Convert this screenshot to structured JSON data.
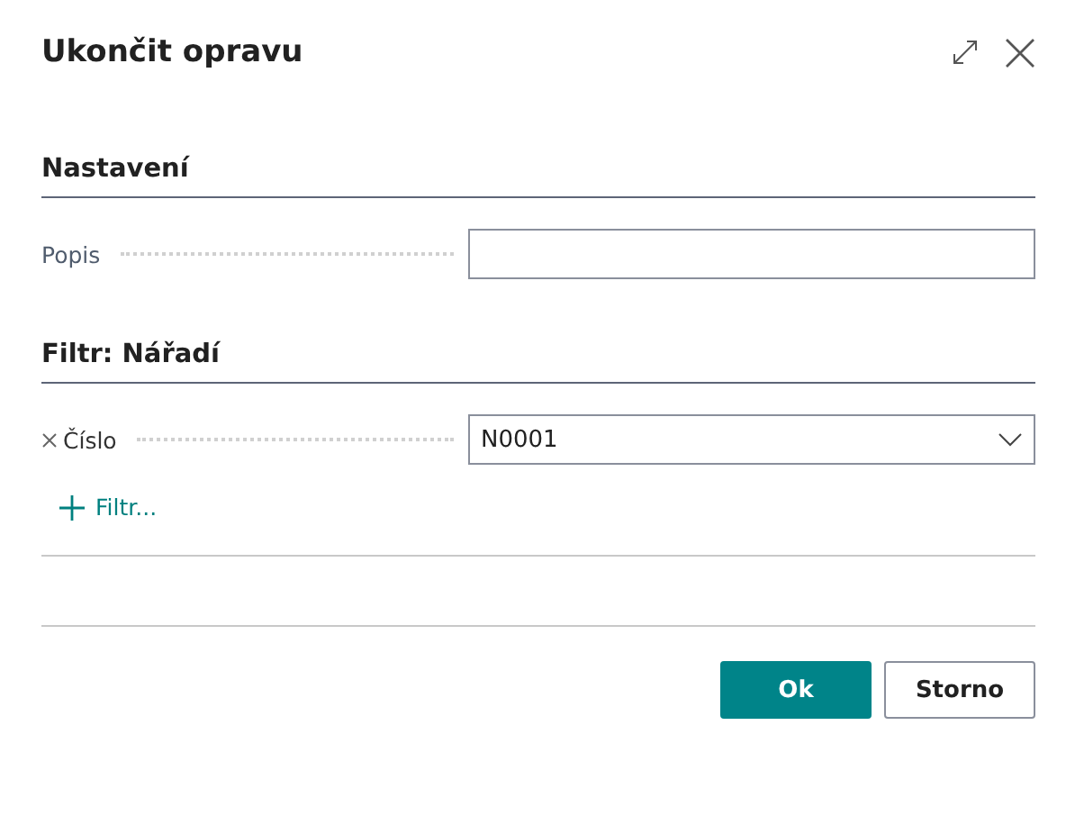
{
  "dialog": {
    "title": "Ukončit opravu"
  },
  "sections": [
    {
      "heading": "Nastavení",
      "fields": [
        {
          "label": "Popis",
          "kind": "text",
          "removable": false
        }
      ]
    },
    {
      "heading": "Filtr: Nářadí",
      "fields": [
        {
          "label": "Číslo",
          "kind": "dropdown",
          "removable": true,
          "value": "N0001"
        }
      ],
      "add_filter": "Filtr..."
    }
  ],
  "buttons": [
    {
      "label": "Ok",
      "kind": "primary"
    },
    {
      "label": "Storno",
      "kind": "secondary"
    }
  ]
}
